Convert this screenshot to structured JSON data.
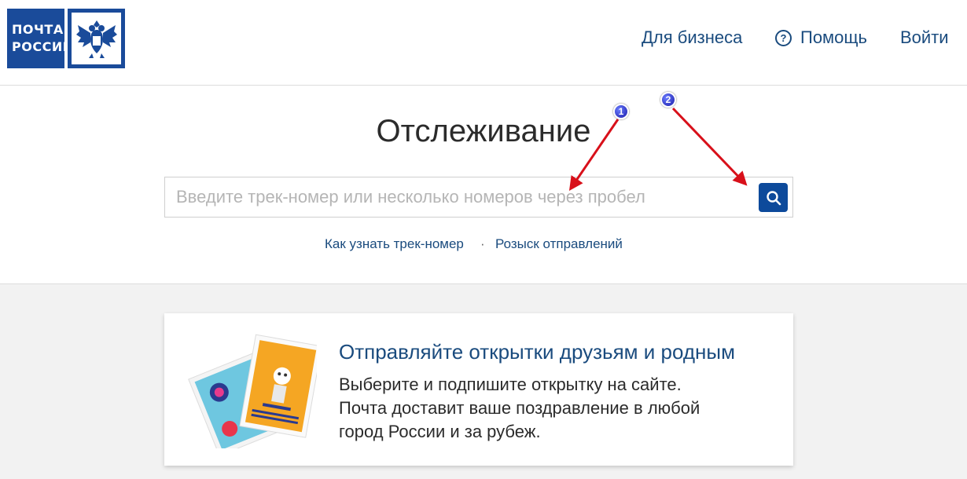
{
  "header": {
    "logo_line1": "ПОЧТА",
    "logo_line2": "РОССИИ",
    "nav_business": "Для бизнеса",
    "nav_help": "Помощь",
    "nav_login": "Войти"
  },
  "tracking": {
    "title": "Отслеживание",
    "search_placeholder": "Введите трек-номер или несколько номеров через пробел",
    "search_value": "",
    "link_how": "Как узнать трек-номер",
    "link_separator": "·",
    "link_search": "Розыск отправлений"
  },
  "promo": {
    "title": "Отправляйте открытки друзьям и родным",
    "line1": "Выберите и подпишите открытку на сайте.",
    "line2": "Почта доставит ваше поздравление в любой",
    "line3": "город России и за рубеж."
  },
  "annotations": {
    "marker1": "1",
    "marker2": "2"
  },
  "colors": {
    "brand_blue": "#1a4b9a",
    "link_blue": "#1a4b7e",
    "button_blue": "#0d4a9b",
    "arrow_red": "#d8101a"
  },
  "icons": {
    "help": "help-circle-icon",
    "search": "search-icon"
  }
}
